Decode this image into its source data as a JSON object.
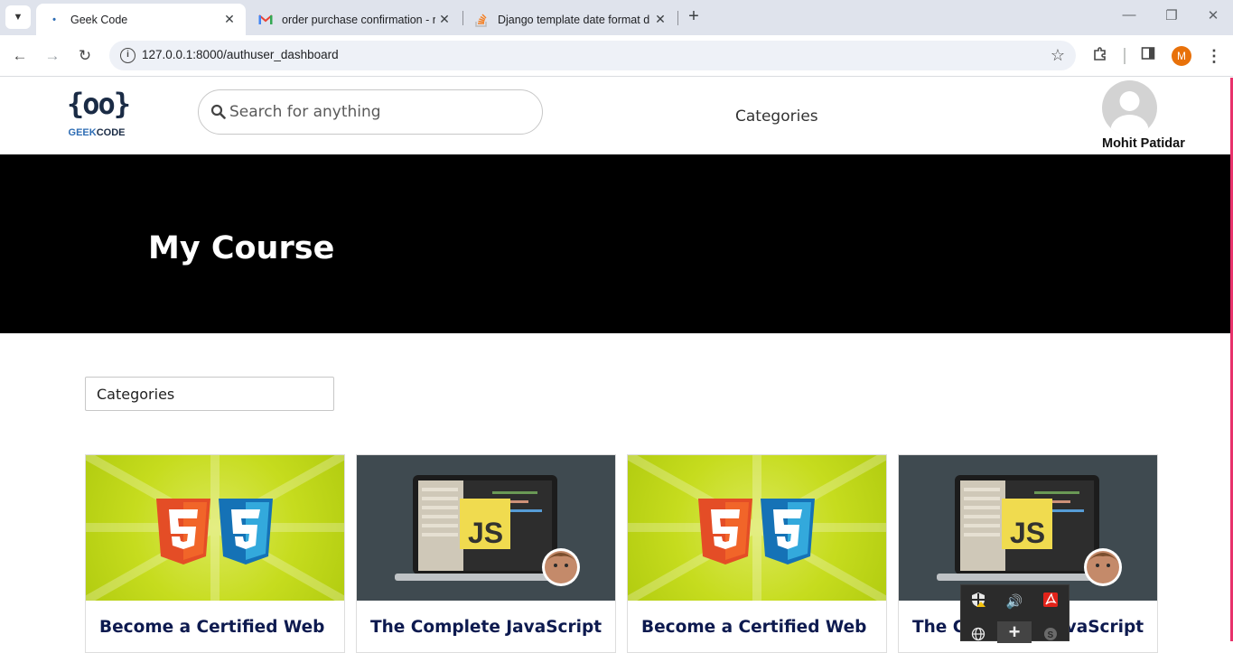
{
  "browser": {
    "tabs": [
      {
        "title": "Geek Code",
        "favicon": "geekcode-favicon",
        "active": true
      },
      {
        "title": "order purchase confirmation - r",
        "favicon": "gmail-icon",
        "active": false
      },
      {
        "title": "Django template date format d",
        "favicon": "stackoverflow-icon",
        "active": false
      }
    ],
    "url": "127.0.0.1:8000/authuser_dashboard",
    "profile_initial": "M"
  },
  "header": {
    "logo_geek": "GEEK",
    "logo_code": "CODE",
    "logo_braces": "{oo}",
    "search_placeholder": "Search for anything",
    "nav_categories": "Categories",
    "username": "Mohit Patidar"
  },
  "hero": {
    "title": "My Course"
  },
  "filter": {
    "select_value": "Categories"
  },
  "courses": [
    {
      "title": "Become a Certified Web",
      "thumbnail": "html-css"
    },
    {
      "title": "The Complete JavaScript",
      "thumbnail": "javascript"
    },
    {
      "title": "Become a Certified Web",
      "thumbnail": "html-css"
    },
    {
      "title": "The Complete JavaScript",
      "thumbnail": "javascript"
    }
  ],
  "colors": {
    "hero_bg": "#000000",
    "card_title": "#0d1a4f",
    "accent_pink": "#e8326b",
    "html_bg": "#c6dc1e",
    "js_bg": "#3f4a50"
  }
}
